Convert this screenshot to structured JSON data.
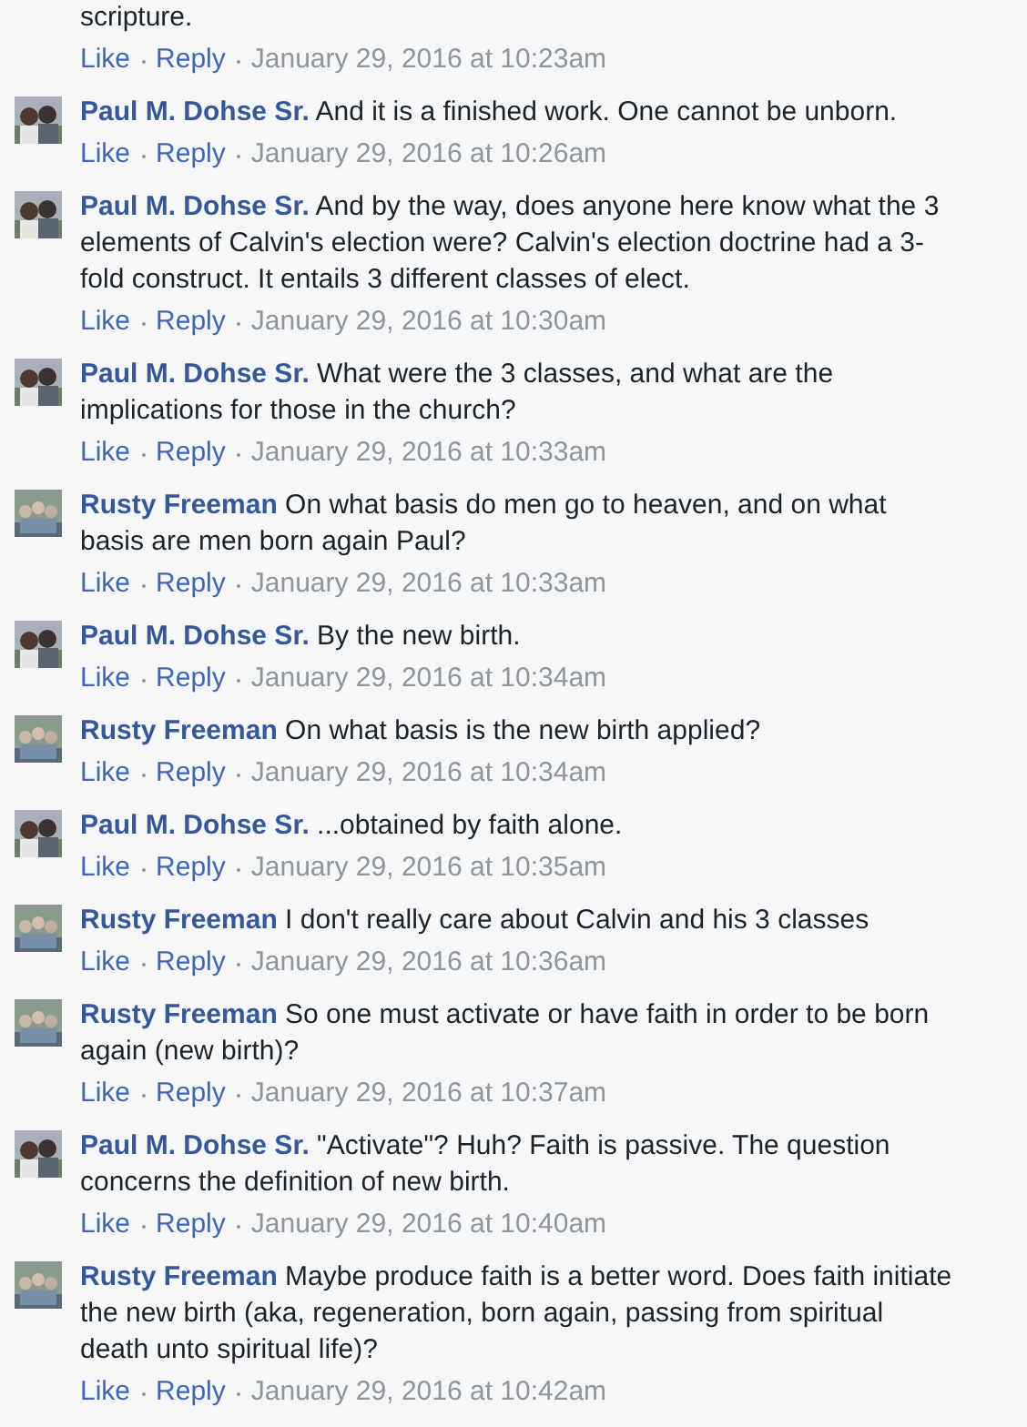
{
  "comments": [
    {
      "text": "scripture.",
      "actions": {
        "like": "Like",
        "reply": "Reply",
        "time": "January 29, 2016 at 10:23am"
      }
    },
    {
      "kind": "pair",
      "author": "Paul M. Dohse Sr.",
      "text": "And it is a finished work. One cannot be unborn.",
      "actions": {
        "like": "Like",
        "reply": "Reply",
        "time": "January 29, 2016 at 10:26am"
      }
    },
    {
      "kind": "pair",
      "author": "Paul M. Dohse Sr.",
      "text": "And by the way, does anyone here know what the 3 elements of Calvin's election were? Calvin's election doctrine had a 3-fold construct. It entails 3 different classes of elect.",
      "actions": {
        "like": "Like",
        "reply": "Reply",
        "time": "January 29, 2016 at 10:30am"
      }
    },
    {
      "kind": "pair",
      "author": "Paul M. Dohse Sr.",
      "text": "What were the 3 classes, and what are the implications for those in the church?",
      "actions": {
        "like": "Like",
        "reply": "Reply",
        "time": "January 29, 2016 at 10:33am"
      }
    },
    {
      "kind": "group",
      "author": "Rusty Freeman",
      "text": "On what basis do men go to heaven, and on what basis are men born again Paul?",
      "actions": {
        "like": "Like",
        "reply": "Reply",
        "time": "January 29, 2016 at 10:33am"
      }
    },
    {
      "kind": "pair",
      "author": "Paul M. Dohse Sr.",
      "text": "By the new birth.",
      "actions": {
        "like": "Like",
        "reply": "Reply",
        "time": "January 29, 2016 at 10:34am"
      }
    },
    {
      "kind": "group",
      "author": "Rusty Freeman",
      "text": "On what basis is the new birth applied?",
      "actions": {
        "like": "Like",
        "reply": "Reply",
        "time": "January 29, 2016 at 10:34am"
      }
    },
    {
      "kind": "pair",
      "author": "Paul M. Dohse Sr.",
      "text": "...obtained by faith alone.",
      "actions": {
        "like": "Like",
        "reply": "Reply",
        "time": "January 29, 2016 at 10:35am"
      }
    },
    {
      "kind": "group",
      "author": "Rusty Freeman",
      "text": "I don't really care about Calvin and his 3 classes",
      "actions": {
        "like": "Like",
        "reply": "Reply",
        "time": "January 29, 2016 at 10:36am"
      }
    },
    {
      "kind": "group",
      "author": "Rusty Freeman",
      "text": "So one must activate or have faith in order to be born again (new birth)?",
      "actions": {
        "like": "Like",
        "reply": "Reply",
        "time": "January 29, 2016 at 10:37am"
      }
    },
    {
      "kind": "pair",
      "author": "Paul M. Dohse Sr.",
      "text": "\"Activate\"? Huh? Faith is passive. The question concerns the definition of new birth.",
      "actions": {
        "like": "Like",
        "reply": "Reply",
        "time": "January 29, 2016 at 10:40am"
      }
    },
    {
      "kind": "group",
      "author": "Rusty Freeman",
      "text": "Maybe produce faith is a better word. Does faith initiate the new birth (aka, regeneration, born again, passing from spiritual death unto spiritual life)?",
      "actions": {
        "like": "Like",
        "reply": "Reply",
        "time": "January 29, 2016 at 10:42am"
      }
    }
  ]
}
